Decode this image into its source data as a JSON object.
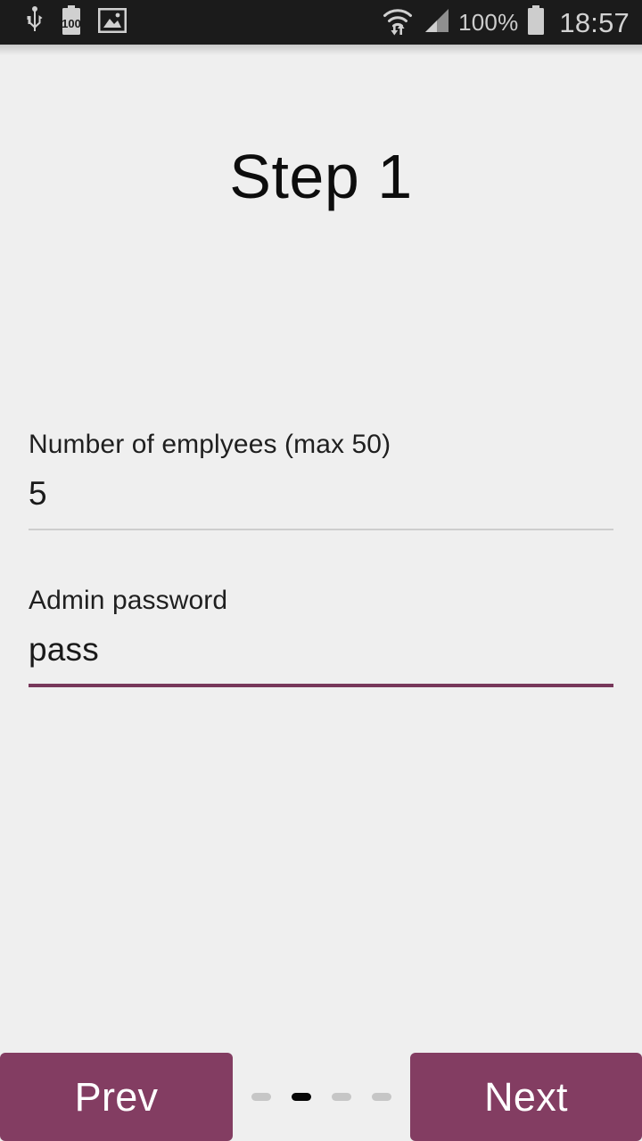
{
  "status_bar": {
    "left_icons": [
      {
        "name": "usb-icon",
        "label": "USB"
      },
      {
        "name": "battery-100-icon",
        "label": "100"
      },
      {
        "name": "image-icon",
        "label": "Screenshot"
      }
    ],
    "right_icons": [
      {
        "name": "wifi-transfer-icon",
        "label": "Wi-Fi"
      },
      {
        "name": "cellular-signal-icon",
        "label": "Signal"
      }
    ],
    "battery_percent": "100%",
    "battery_icon": "battery-full-icon",
    "clock": "18:57",
    "background_color": "#1b1b1b",
    "text_color": "#cdcdcd"
  },
  "screen": {
    "title": "Step 1",
    "background_color": "#efefef"
  },
  "form": {
    "fields": [
      {
        "label": "Number of emplyees (max 50)",
        "value": "5",
        "focused": false,
        "underline_color": "#cdcdcd"
      },
      {
        "label": "Admin password",
        "value": "pass",
        "focused": true,
        "underline_color": "#77375a"
      }
    ]
  },
  "bottom_bar": {
    "prev_label": "Prev",
    "next_label": "Next",
    "button_color": "#833d62",
    "button_text_color": "#ffffff",
    "page_indicator": {
      "total": 4,
      "active_index": 1,
      "active_color": "#070707",
      "inactive_color": "#c6c6c6"
    }
  }
}
